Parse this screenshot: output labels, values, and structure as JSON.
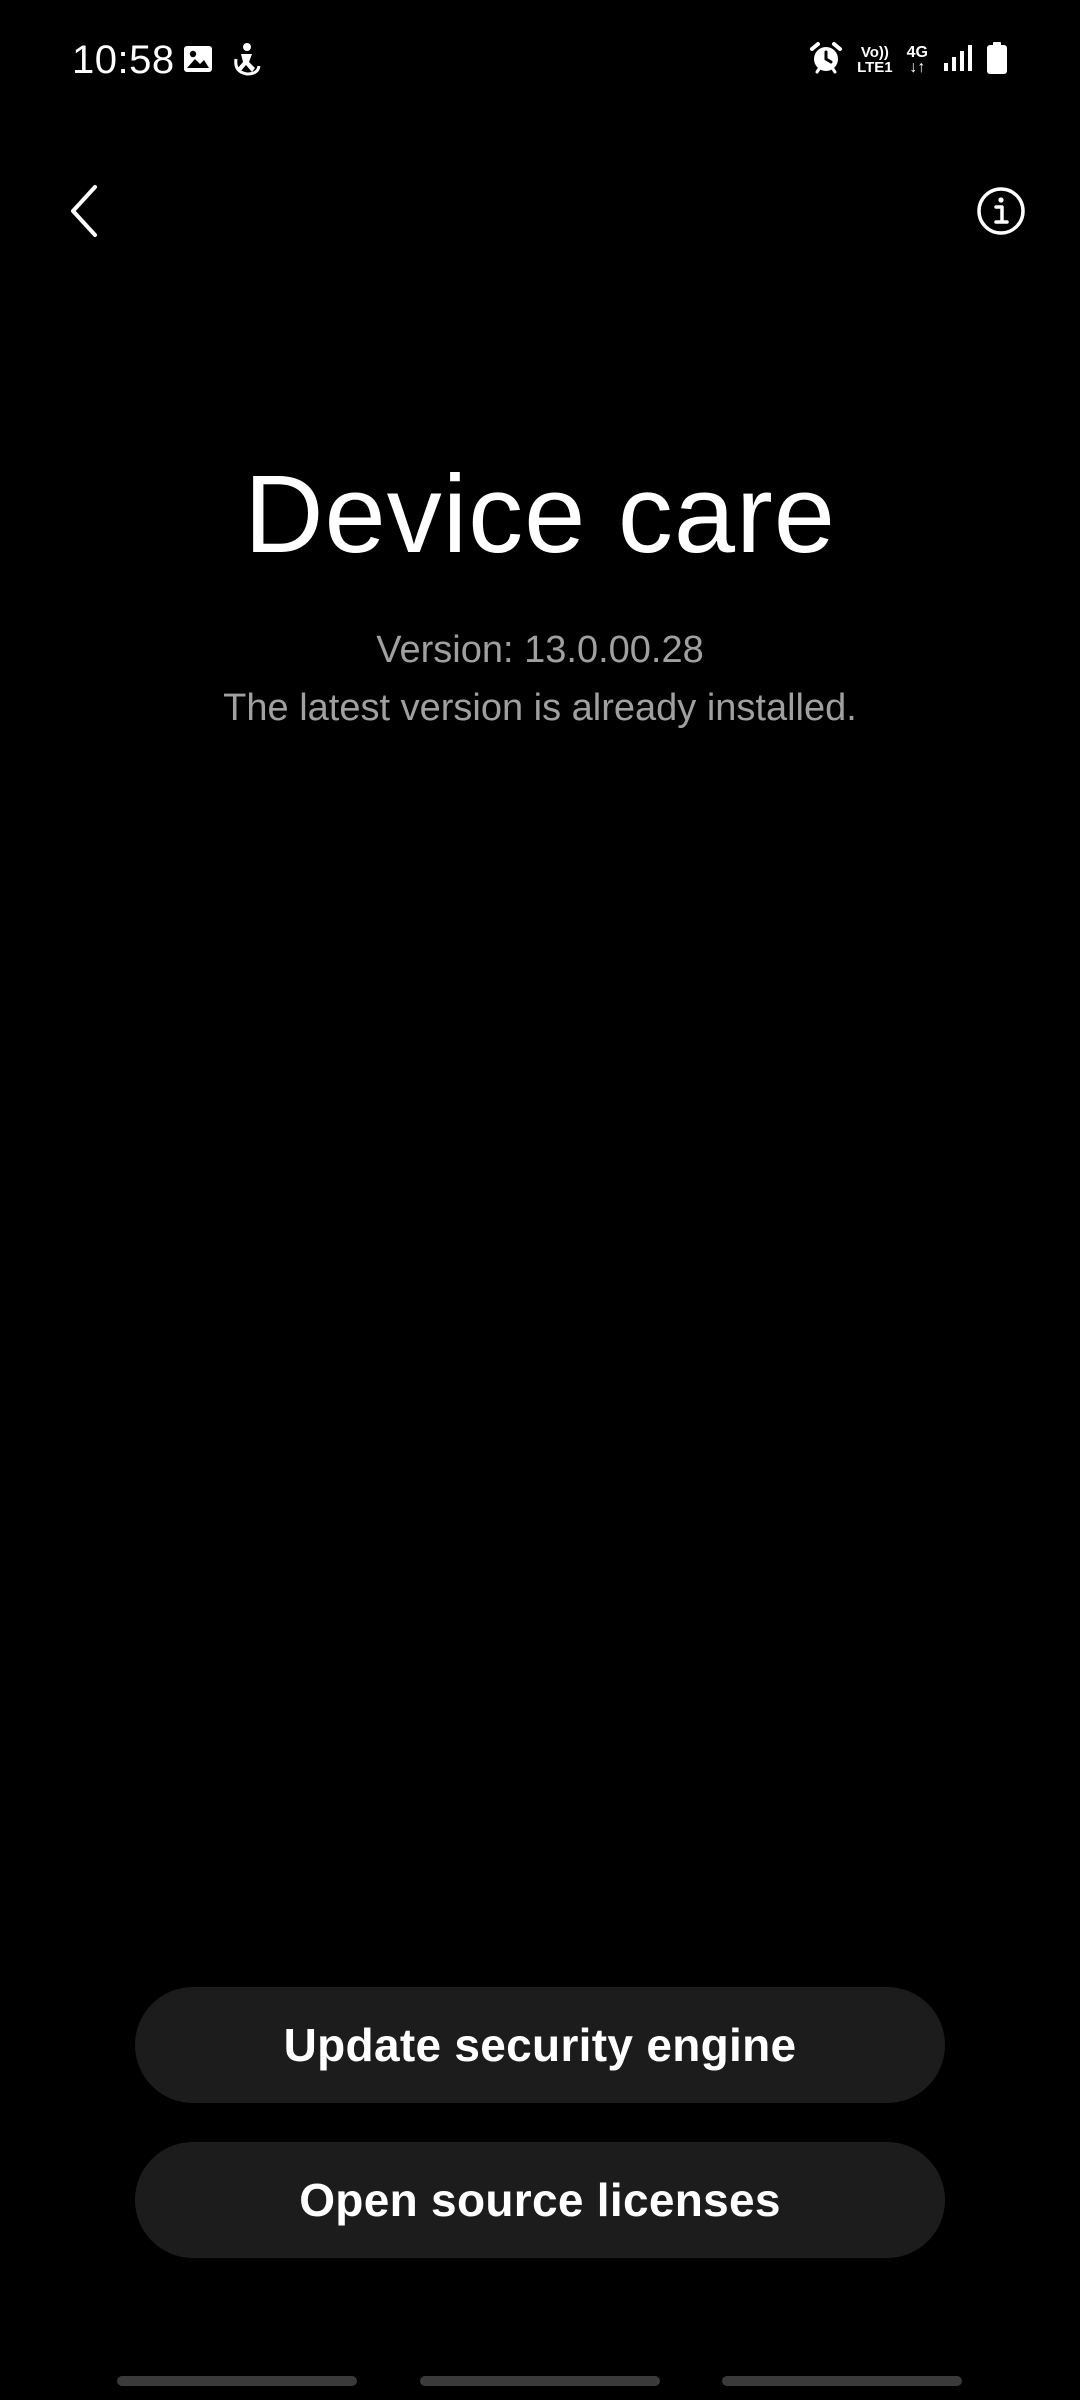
{
  "status_bar": {
    "time": "10:58",
    "left_icons": [
      "image-icon",
      "accessibility-person-icon"
    ],
    "right_icons": [
      "alarm-icon",
      "volte-lte-icon",
      "4g-data-icon",
      "signal-icon",
      "battery-icon"
    ],
    "volte_line1": "Vo))",
    "volte_line2": "LTE1",
    "fourg_line1": "4G",
    "fourg_line2": "↓↑"
  },
  "header": {
    "back_icon": "chevron-left-icon",
    "info_icon": "info-icon"
  },
  "main": {
    "title": "Device care",
    "version": "Version: 13.0.00.28",
    "status": "The latest version is already installed."
  },
  "actions": {
    "update_label": "Update security engine",
    "licenses_label": "Open source licenses"
  },
  "colors": {
    "background": "#000000",
    "text_primary": "#ffffff",
    "text_secondary": "#a0a0a0",
    "button_bg": "#1c1c1c",
    "nav_handle": "#3a3a3a"
  }
}
